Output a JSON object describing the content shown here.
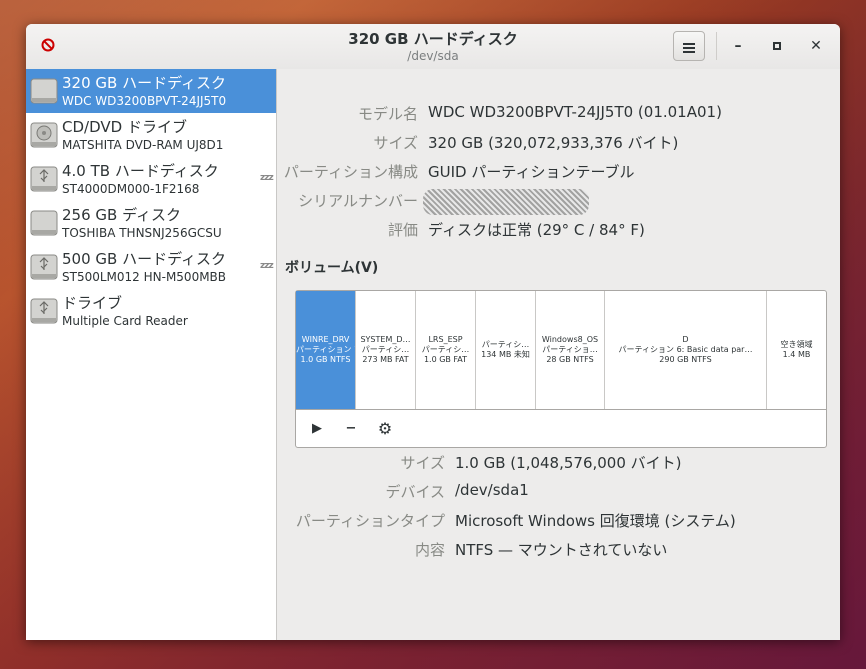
{
  "window": {
    "title": "320 GB ハードディスク",
    "subtitle": "/dev/sda",
    "menu_icon": "hamburger-icon",
    "minimize": "–",
    "maximize": "□",
    "close": "✕"
  },
  "drives": [
    {
      "name": "320 GB ハードディスク",
      "model": "WDC WD3200BPVT-24JJ5T0",
      "icon": "harddisk-icon",
      "selected": true,
      "sleeping": false
    },
    {
      "name": "CD/DVD ドライブ",
      "model": "MATSHITA DVD-RAM UJ8D1",
      "icon": "optical-drive-icon",
      "selected": false,
      "sleeping": false
    },
    {
      "name": "4.0 TB ハードディスク",
      "model": "ST4000DM000-1F2168",
      "icon": "usb-harddisk-icon",
      "selected": false,
      "sleeping": true
    },
    {
      "name": "256 GB ディスク",
      "model": "TOSHIBA THNSNJ256GCSU",
      "icon": "harddisk-icon",
      "selected": false,
      "sleeping": false
    },
    {
      "name": "500 GB ハードディスク",
      "model": "ST500LM012 HN-M500MBB",
      "icon": "usb-harddisk-icon",
      "selected": false,
      "sleeping": true
    },
    {
      "name": "ドライブ",
      "model": "Multiple Card  Reader",
      "icon": "usb-drive-icon",
      "selected": false,
      "sleeping": false
    }
  ],
  "sleep_label": "zzz",
  "disk_props": [
    {
      "label": "モデル名",
      "value": "WDC WD3200BPVT-24JJ5T0 (01.01A01)"
    },
    {
      "label": "サイズ",
      "value": "320 GB (320,072,933,376 バイト)"
    },
    {
      "label": "パーティション構成",
      "value": "GUID パーティションテーブル"
    },
    {
      "label": "シリアルナンバー",
      "value": ""
    },
    {
      "label": "評価",
      "value": "ディスクは正常 (29° C / 84° F)"
    }
  ],
  "volumes_heading": "ボリューム(V)",
  "partitions": [
    {
      "lines": [
        "WINRE_DRV",
        "パーティション 1",
        "1.0 GB NTFS"
      ],
      "selected": true
    },
    {
      "lines": [
        "SYSTEM_D…",
        "パーティシ…",
        "273 MB FAT"
      ],
      "selected": false
    },
    {
      "lines": [
        "LRS_ESP",
        "パーティシ…",
        "1.0 GB FAT"
      ],
      "selected": false
    },
    {
      "lines": [
        "パーティシ…",
        "134 MB 未知"
      ],
      "selected": false
    },
    {
      "lines": [
        "Windows8_OS",
        "パーティショ…",
        "28 GB NTFS"
      ],
      "selected": false
    },
    {
      "lines": [
        "D",
        "パーティション 6: Basic data par…",
        "290 GB NTFS"
      ],
      "selected": false
    },
    {
      "lines": [
        "空き領域",
        "1.4 MB"
      ],
      "selected": false
    }
  ],
  "volume_tools": {
    "play": "▶",
    "minus": "−",
    "gear": "⚙"
  },
  "partition_props": [
    {
      "label": "サイズ",
      "value": "1.0 GB (1,048,576,000 バイト)"
    },
    {
      "label": "デバイス",
      "value": "/dev/sda1"
    },
    {
      "label": "パーティションタイプ",
      "value": "Microsoft Windows 回復環境 (システム)"
    },
    {
      "label": "内容",
      "value": "NTFS — マウントされていない"
    }
  ]
}
